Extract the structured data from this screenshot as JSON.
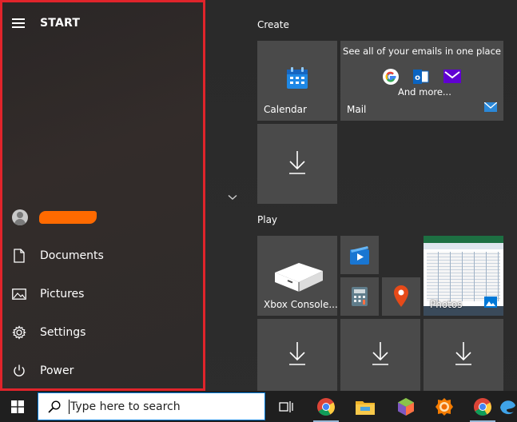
{
  "start_menu": {
    "title": "START",
    "rail": {
      "documents": "Documents",
      "pictures": "Pictures",
      "settings": "Settings",
      "power": "Power"
    }
  },
  "groups": {
    "create": "Create",
    "play": "Play"
  },
  "tiles": {
    "calendar": "Calendar",
    "mail": "Mail",
    "mail_header": "See all of your emails in one place",
    "mail_more": "And more...",
    "xbox": "Xbox Console...",
    "photos": "Photos"
  },
  "taskbar": {
    "search_placeholder": "Type here to search"
  },
  "colors": {
    "highlight_border": "#e0242b",
    "redaction": "#ff6a00",
    "calendar_blue": "#1e88e5",
    "tile_bg": "#4a4a4a"
  }
}
